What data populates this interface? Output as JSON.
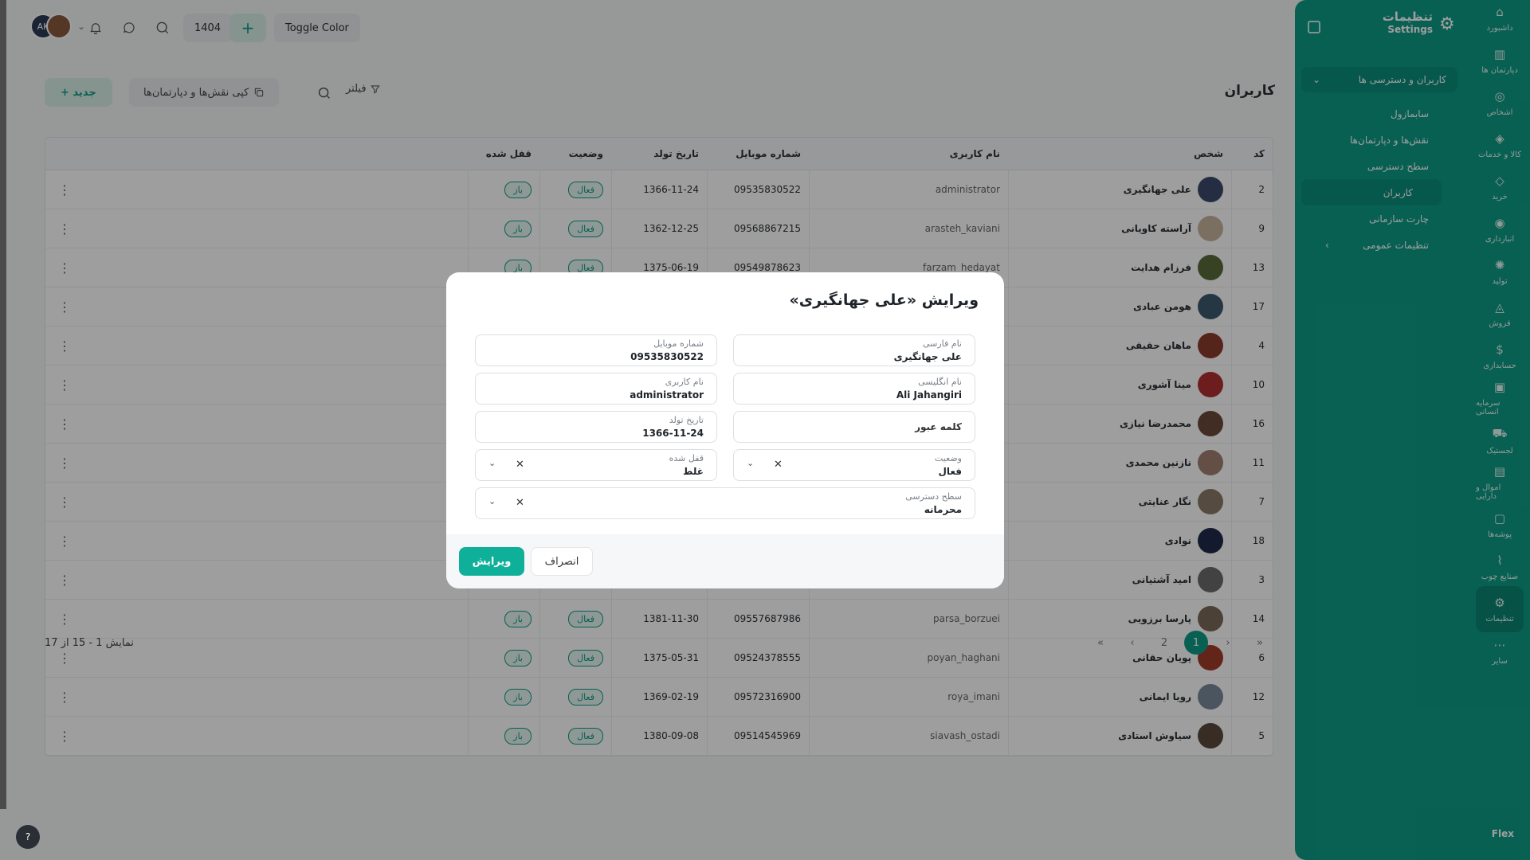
{
  "topbar": {
    "avatar_initials": "AK",
    "year": "1404",
    "toggle_color": "Toggle Color",
    "plus": "+"
  },
  "page": {
    "title": "کاربران",
    "new_button": "+ جدید",
    "copy_button": "کپی نقش‌ها و دپارتمان‌ها",
    "filter_button": "فیلتر"
  },
  "table": {
    "headers": {
      "code": "کد",
      "person": "شخص",
      "username": "نام کاربری",
      "mobile": "شماره موبایل",
      "birth": "تاریخ تولد",
      "status": "وضعیت",
      "locked": "قفل شده"
    },
    "rows": [
      {
        "code": "2",
        "person": "علی جهانگیری",
        "username": "administrator",
        "mobile": "09535830522",
        "birth": "1366-11-24",
        "status": "فعال",
        "locked": "باز"
      },
      {
        "code": "9",
        "person": "آراسته کاویانی",
        "username": "arasteh_kaviani",
        "mobile": "09568867215",
        "birth": "1362-12-25",
        "status": "فعال",
        "locked": "باز"
      },
      {
        "code": "13",
        "person": "فرزام هدایت",
        "username": "farzam_hedayat",
        "mobile": "09549878623",
        "birth": "1375-06-19",
        "status": "فعال",
        "locked": "باز"
      },
      {
        "code": "17",
        "person": "هومن عبادی",
        "username": "",
        "mobile": "",
        "birth": "",
        "status": "",
        "locked": ""
      },
      {
        "code": "4",
        "person": "ماهان حقیقی",
        "username": "",
        "mobile": "",
        "birth": "",
        "status": "",
        "locked": ""
      },
      {
        "code": "10",
        "person": "مینا آشوری",
        "username": "",
        "mobile": "",
        "birth": "",
        "status": "",
        "locked": ""
      },
      {
        "code": "16",
        "person": "محمدرضا نیازی",
        "username": "",
        "mobile": "",
        "birth": "",
        "status": "",
        "locked": ""
      },
      {
        "code": "11",
        "person": "نازنین محمدی",
        "username": "",
        "mobile": "",
        "birth": "",
        "status": "",
        "locked": ""
      },
      {
        "code": "7",
        "person": "نگار عنایتی",
        "username": "",
        "mobile": "",
        "birth": "",
        "status": "",
        "locked": ""
      },
      {
        "code": "18",
        "person": "نوادی",
        "username": "",
        "mobile": "",
        "birth": "",
        "status": "",
        "locked": ""
      },
      {
        "code": "3",
        "person": "امید آشتیانی",
        "username": "",
        "mobile": "",
        "birth": "",
        "status": "",
        "locked": ""
      },
      {
        "code": "14",
        "person": "پارسا برزویی",
        "username": "parsa_borzuei",
        "mobile": "09557687986",
        "birth": "1381-11-30",
        "status": "فعال",
        "locked": "باز"
      },
      {
        "code": "6",
        "person": "پویان حقانی",
        "username": "poyan_haghani",
        "mobile": "09524378555",
        "birth": "1375-05-31",
        "status": "فعال",
        "locked": "باز"
      },
      {
        "code": "12",
        "person": "رویا ایمانی",
        "username": "roya_imani",
        "mobile": "09572316900",
        "birth": "1369-02-19",
        "status": "فعال",
        "locked": "باز"
      },
      {
        "code": "5",
        "person": "سیاوش استادی",
        "username": "siavash_ostadi",
        "mobile": "09514545969",
        "birth": "1380-09-08",
        "status": "فعال",
        "locked": "باز"
      }
    ]
  },
  "footer": {
    "count": "نمایش 1 - 15 از 17",
    "pages": [
      "2",
      "1"
    ],
    "active_page": "1"
  },
  "sidebar": {
    "title": "تنظیمات",
    "subtitle": "Settings",
    "icons": [
      "داشبورد",
      "دپارتمان ها",
      "اشخاص",
      "کالا و خدمات",
      "خرید",
      "انبارداری",
      "تولید",
      "فروش",
      "حسابداری",
      "سرمایه انسانی",
      "لجستیک",
      "اموال و دارایی",
      "پوشه‌ها",
      "صنایع چوب",
      "تنظیمات",
      "سایر"
    ],
    "group": "کاربران و دسترسی ها",
    "subitems": [
      "سابمازول",
      "نقش‌ها و دپارتمان‌ها",
      "سطح دسترسی",
      "کاربران",
      "چارت سازمانی",
      "تنظیمات عمومی"
    ],
    "logo": "Flex"
  },
  "modal": {
    "title": "ویرایش «علی جهانگیری»",
    "fields": {
      "persian_name": {
        "label": "نام فارسی",
        "value": "علی جهانگیری"
      },
      "mobile": {
        "label": "شماره موبایل",
        "value": "09535830522"
      },
      "english_name": {
        "label": "نام انگلیسی",
        "value": "Ali Jahangiri"
      },
      "username": {
        "label": "نام کاربری",
        "value": "administrator"
      },
      "password": {
        "placeholder": "کلمه عبور"
      },
      "birth": {
        "label": "تاریخ تولد",
        "value": "1366-11-24"
      },
      "status": {
        "label": "وضعیت",
        "value": "فعال"
      },
      "locked": {
        "label": "قفل شده",
        "value": "غلط"
      },
      "access": {
        "label": "سطح دسترسی",
        "value": "محرمانه"
      }
    },
    "edit_button": "ویرایش",
    "cancel_button": "انصراف"
  },
  "colors": {
    "accent": "#0d9c86",
    "sidebar": "#0d9c86"
  }
}
